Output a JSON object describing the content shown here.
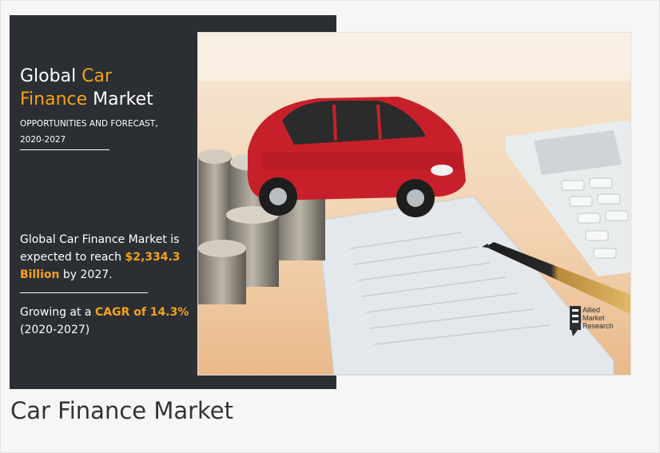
{
  "infographic": {
    "title_part1": "Global ",
    "title_highlight1": "Car",
    "title_highlight2": "Finance",
    "title_part2": " Market",
    "subtitle_line1": "OPPORTUNITIES AND FORECAST,",
    "subtitle_line2": "2020-2027",
    "desc_part1": "Global Car Finance Market is expected to reach ",
    "desc_value": "$2,334.3 Billion",
    "desc_part2": " by 2027.",
    "growth_part1": "Growing at a ",
    "growth_value": "CAGR of 14.3%",
    "growth_period": "(2020-2027)",
    "brand_line1": "Allied",
    "brand_line2": "Market",
    "brand_line3": "Research",
    "accent_color": "#f5a21b",
    "panel_color": "#2b2e33"
  },
  "caption": "Car Finance Market"
}
